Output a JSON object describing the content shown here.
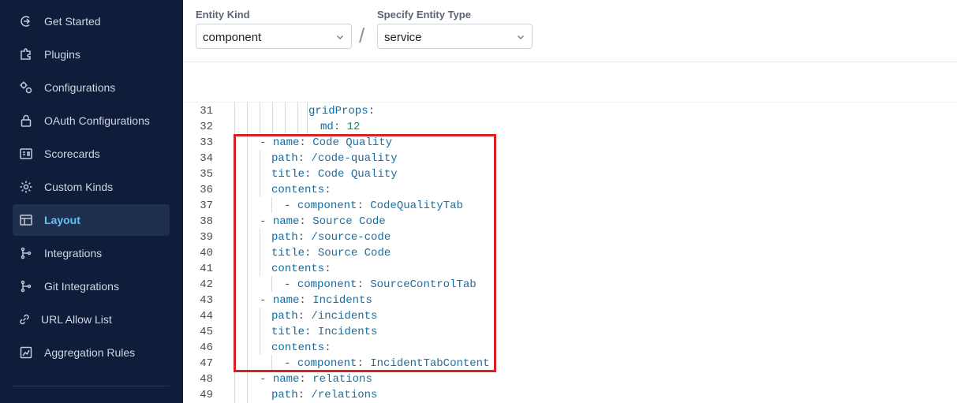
{
  "sidebar": {
    "items": [
      {
        "label": "Get Started",
        "icon": "get-started-icon"
      },
      {
        "label": "Plugins",
        "icon": "plugins-icon"
      },
      {
        "label": "Configurations",
        "icon": "configurations-icon"
      },
      {
        "label": "OAuth Configurations",
        "icon": "lock-icon"
      },
      {
        "label": "Scorecards",
        "icon": "scorecards-icon"
      },
      {
        "label": "Custom Kinds",
        "icon": "gear-icon"
      },
      {
        "label": "Layout",
        "icon": "layout-icon",
        "active": true
      },
      {
        "label": "Integrations",
        "icon": "integrations-icon"
      },
      {
        "label": "Git Integrations",
        "icon": "git-icon"
      },
      {
        "label": "URL Allow List",
        "icon": "link-icon"
      },
      {
        "label": "Aggregation Rules",
        "icon": "chart-icon"
      }
    ]
  },
  "header": {
    "entity_kind_label": "Entity Kind",
    "entity_kind_value": "component",
    "separator": "/",
    "entity_type_label": "Specify Entity Type",
    "entity_type_value": "service"
  },
  "editor": {
    "lines": [
      {
        "n": "31",
        "key": "gridProps",
        "sep": ":",
        "val": ""
      },
      {
        "n": "32",
        "key": "md",
        "sep": ": ",
        "val": "12"
      },
      {
        "n": "33",
        "dash": "- ",
        "key": "name",
        "sep": ": ",
        "val": "Code Quality"
      },
      {
        "n": "34",
        "key": "path",
        "sep": ": ",
        "val": "/code-quality"
      },
      {
        "n": "35",
        "key": "title",
        "sep": ": ",
        "val": "Code Quality"
      },
      {
        "n": "36",
        "key": "contents",
        "sep": ":",
        "val": ""
      },
      {
        "n": "37",
        "dash": "- ",
        "key": "component",
        "sep": ": ",
        "val": "CodeQualityTab"
      },
      {
        "n": "38",
        "dash": "- ",
        "key": "name",
        "sep": ": ",
        "val": "Source Code"
      },
      {
        "n": "39",
        "key": "path",
        "sep": ": ",
        "val": "/source-code"
      },
      {
        "n": "40",
        "key": "title",
        "sep": ": ",
        "val": "Source Code"
      },
      {
        "n": "41",
        "key": "contents",
        "sep": ":",
        "val": ""
      },
      {
        "n": "42",
        "dash": "- ",
        "key": "component",
        "sep": ": ",
        "val": "SourceControlTab"
      },
      {
        "n": "43",
        "dash": "- ",
        "key": "name",
        "sep": ": ",
        "val": "Incidents"
      },
      {
        "n": "44",
        "key": "path",
        "sep": ": ",
        "val": "/incidents"
      },
      {
        "n": "45",
        "key": "title",
        "sep": ": ",
        "val": "Incidents"
      },
      {
        "n": "46",
        "key": "contents",
        "sep": ":",
        "val": ""
      },
      {
        "n": "47",
        "dash": "- ",
        "key": "component",
        "sep": ": ",
        "val": "IncidentTabContent"
      },
      {
        "n": "48",
        "dash": "- ",
        "key": "name",
        "sep": ": ",
        "val": "relations"
      },
      {
        "n": "49",
        "key": "path",
        "sep": ": ",
        "val": "/relations"
      }
    ]
  },
  "colors": {
    "sidebar_bg": "#0f1c3a",
    "active_accent": "#5fc4f5",
    "highlight": "#d92121",
    "yaml_key": "#0d6ea5"
  }
}
